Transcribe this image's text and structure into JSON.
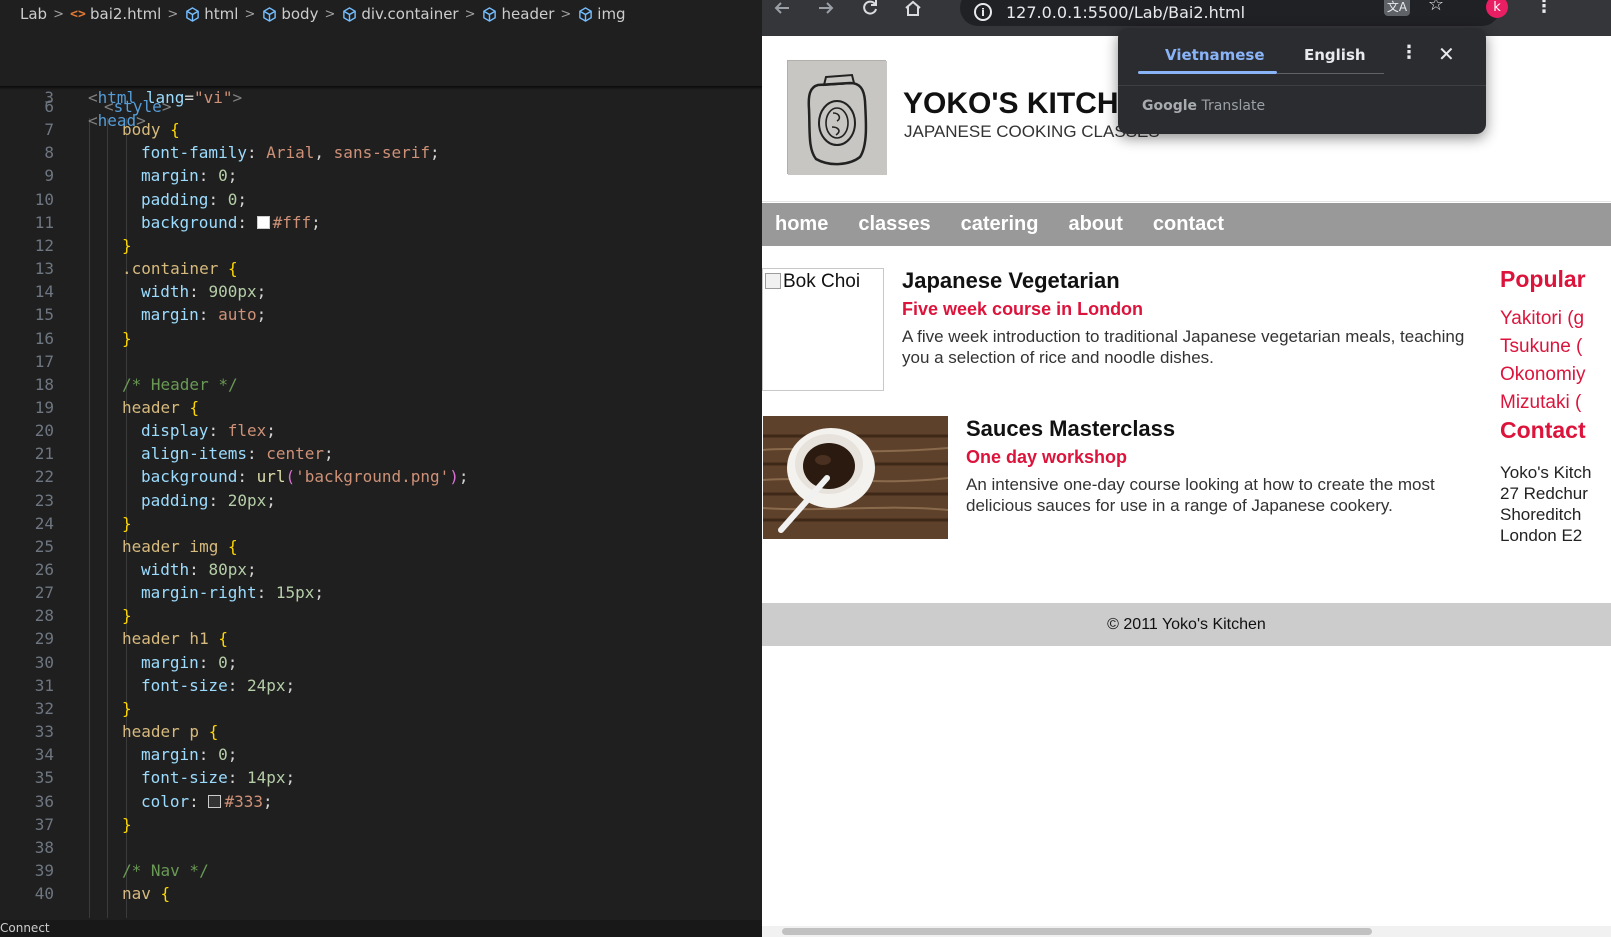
{
  "editor": {
    "breadcrumb": [
      "Lab",
      "bai2.html",
      "html",
      "body",
      "div.container",
      "header",
      "img"
    ],
    "sticky_lines": [
      {
        "n": "2",
        "code": "<html lang=\"vi\">"
      },
      {
        "n": "3",
        "code": "<head>"
      }
    ],
    "lines": [
      {
        "n": "6",
        "code": "<style>"
      },
      {
        "n": "7",
        "code": "body {"
      },
      {
        "n": "8",
        "code": "font-family: Arial, sans-serif;"
      },
      {
        "n": "9",
        "code": "margin: 0;"
      },
      {
        "n": "10",
        "code": "padding: 0;"
      },
      {
        "n": "11",
        "code": "background: #fff;"
      },
      {
        "n": "12",
        "code": "}"
      },
      {
        "n": "13",
        "code": ".container {"
      },
      {
        "n": "14",
        "code": "width: 900px;"
      },
      {
        "n": "15",
        "code": "margin: auto;"
      },
      {
        "n": "16",
        "code": "}"
      },
      {
        "n": "17",
        "code": ""
      },
      {
        "n": "18",
        "code": "/* Header */"
      },
      {
        "n": "19",
        "code": "header {"
      },
      {
        "n": "20",
        "code": "display: flex;"
      },
      {
        "n": "21",
        "code": "align-items: center;"
      },
      {
        "n": "22",
        "code": "background: url('background.png');"
      },
      {
        "n": "23",
        "code": "padding: 20px;"
      },
      {
        "n": "24",
        "code": "}"
      },
      {
        "n": "25",
        "code": "header img {"
      },
      {
        "n": "26",
        "code": "width: 80px;"
      },
      {
        "n": "27",
        "code": "margin-right: 15px;"
      },
      {
        "n": "28",
        "code": "}"
      },
      {
        "n": "29",
        "code": "header h1 {"
      },
      {
        "n": "30",
        "code": "margin: 0;"
      },
      {
        "n": "31",
        "code": "font-size: 24px;"
      },
      {
        "n": "32",
        "code": "}"
      },
      {
        "n": "33",
        "code": "header p {"
      },
      {
        "n": "34",
        "code": "margin: 0;"
      },
      {
        "n": "35",
        "code": "font-size: 14px;"
      },
      {
        "n": "36",
        "code": "color: #333;"
      },
      {
        "n": "37",
        "code": "}"
      },
      {
        "n": "38",
        "code": ""
      },
      {
        "n": "39",
        "code": "/* Nav */"
      },
      {
        "n": "40",
        "code": "nav {"
      }
    ],
    "status": "Connect"
  },
  "browser": {
    "url": "127.0.0.1:5500/Lab/Bai2.html",
    "profile_initial": "k",
    "accent_profile": "#e91e63"
  },
  "translate": {
    "tab_active": "Vietnamese",
    "tab_other": "English",
    "brand_google": "Google",
    "brand_translate": "Translate"
  },
  "site": {
    "title": "YOKO'S KITCHEN",
    "subtitle": "JAPANESE COOKING CLASSES",
    "nav": [
      "home",
      "classes",
      "catering",
      "about",
      "contact"
    ],
    "courses": [
      {
        "img_alt": "Bok Choi",
        "title": "Japanese Vegetarian",
        "subtitle": "Five week course in London",
        "desc_1": "A five week introduction to traditional Japanese vegetarian meals, teaching",
        "desc_2": "you a selection of rice and noodle dishes."
      },
      {
        "title": "Sauces Masterclass",
        "subtitle": "One day workshop",
        "desc_1": "An intensive one-day course looking at how to create the most",
        "desc_2": "delicious sauces for use in a range of Japanese cookery."
      }
    ],
    "sidebar": {
      "popular_heading": "Popular",
      "popular_items": [
        "Yakitori (g",
        "Tsukune (",
        "Okonomiy",
        "Mizutaki ("
      ],
      "contact_heading": "Contact",
      "address": [
        "Yoko's Kitch",
        "27 Redchur",
        "Shoreditch",
        "London E2"
      ]
    },
    "footer": "© 2011 Yoko's Kitchen",
    "accent_color": "#dc143c",
    "nav_bg": "#999999"
  }
}
